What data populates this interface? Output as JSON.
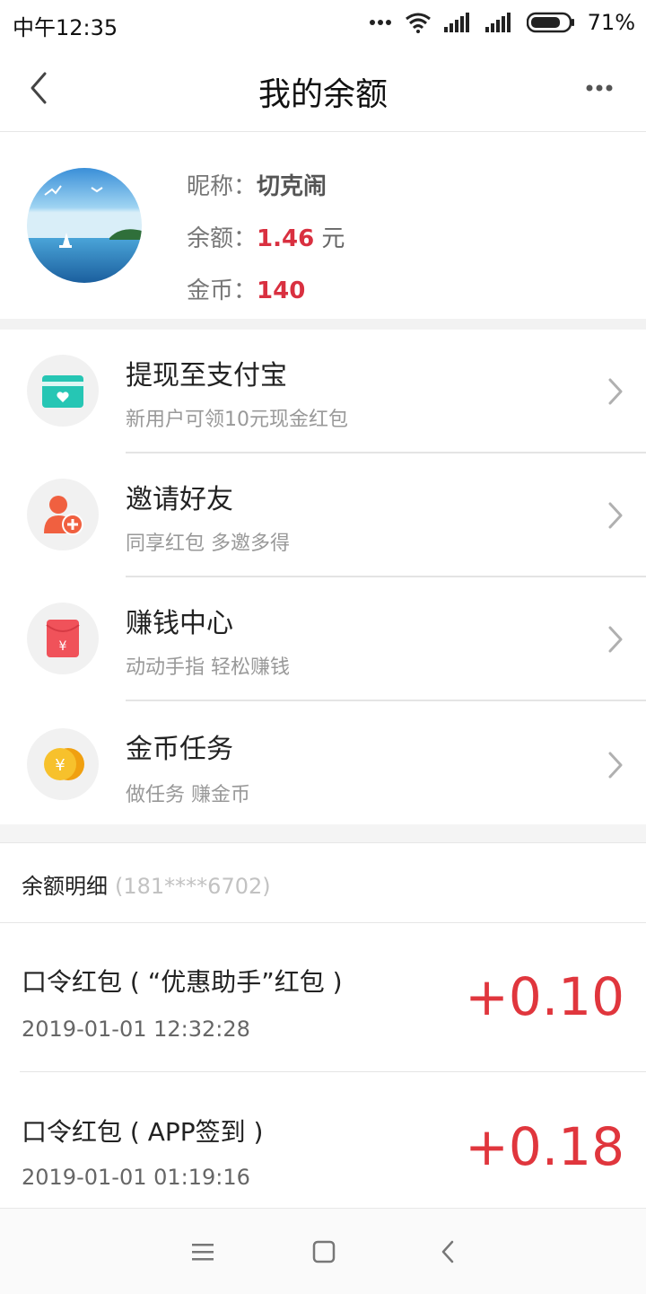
{
  "status": {
    "time": "中午12:35",
    "battery": "71%"
  },
  "nav": {
    "title": "我的余额"
  },
  "profile": {
    "nickname_label": "昵称：",
    "nickname": "切克闹",
    "balance_label": "余额：",
    "balance": "1.46",
    "balance_unit": " 元",
    "coins_label": "金币：",
    "coins": "140"
  },
  "menu": [
    {
      "title": "提现至支付宝",
      "subtitle": "新用户可领10元现金红包",
      "icon": "wallet-icon"
    },
    {
      "title": "邀请好友",
      "subtitle": "同享红包 多邀多得",
      "icon": "add-user-icon"
    },
    {
      "title": "赚钱中心",
      "subtitle": "动动手指 轻松赚钱",
      "icon": "red-envelope-icon"
    },
    {
      "title": "金币任务",
      "subtitle": "做任务 赚金币",
      "icon": "gold-coin-icon"
    }
  ],
  "details": {
    "label": "余额明细",
    "phone": "(181****6702)",
    "records": [
      {
        "title": "口令红包 ( “优惠助手”红包 )",
        "time": "2019-01-01 12:32:28",
        "amount": "+0.10"
      },
      {
        "title": "口令红包 ( APP签到 )",
        "time": "2019-01-01 01:19:16",
        "amount": "+0.18"
      }
    ]
  },
  "colors": {
    "accent_red": "#e0363d",
    "value_red": "#d93040",
    "wallet_teal": "#26c6b4",
    "user_orange": "#f06040",
    "envelope_red": "#f0525a",
    "coin_gold": "#f5b21c"
  }
}
